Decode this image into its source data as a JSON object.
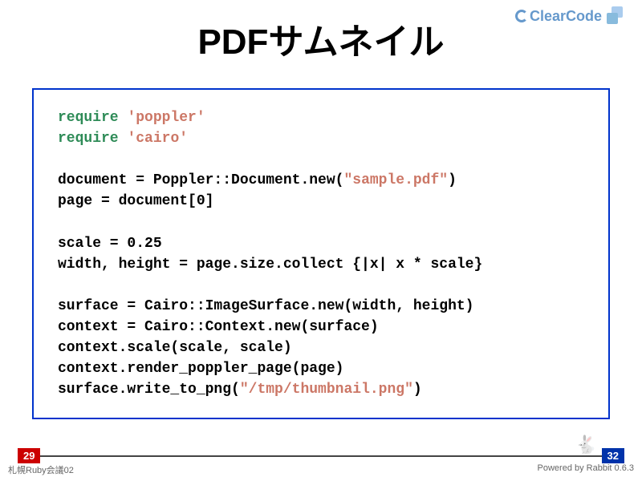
{
  "logo": {
    "text": "ClearCode"
  },
  "title": "PDFサムネイル",
  "code": {
    "l1_kw": "require",
    "l1_str": "'poppler'",
    "l2_kw": "require",
    "l2_str": "'cairo'",
    "l3a": "document = Poppler::Document.new(",
    "l3_str": "\"sample.pdf\"",
    "l3b": ")",
    "l4": "page = document[0]",
    "l5": "scale = 0.25",
    "l6": "width, height = page.size.collect {|x| x * scale}",
    "l7": "surface = Cairo::ImageSurface.new(width, height)",
    "l8": "context = Cairo::Context.new(surface)",
    "l9": "context.scale(scale, scale)",
    "l10": "context.render_poppler_page(page)",
    "l11a": "surface.write_to_png(",
    "l11_str": "\"/tmp/thumbnail.png\"",
    "l11b": ")"
  },
  "page": {
    "current": "29",
    "total": "32"
  },
  "footer": {
    "left": "札幌Ruby会議02",
    "right": "Powered by Rabbit 0.6.3"
  },
  "rabbit_glyph": "🐇"
}
